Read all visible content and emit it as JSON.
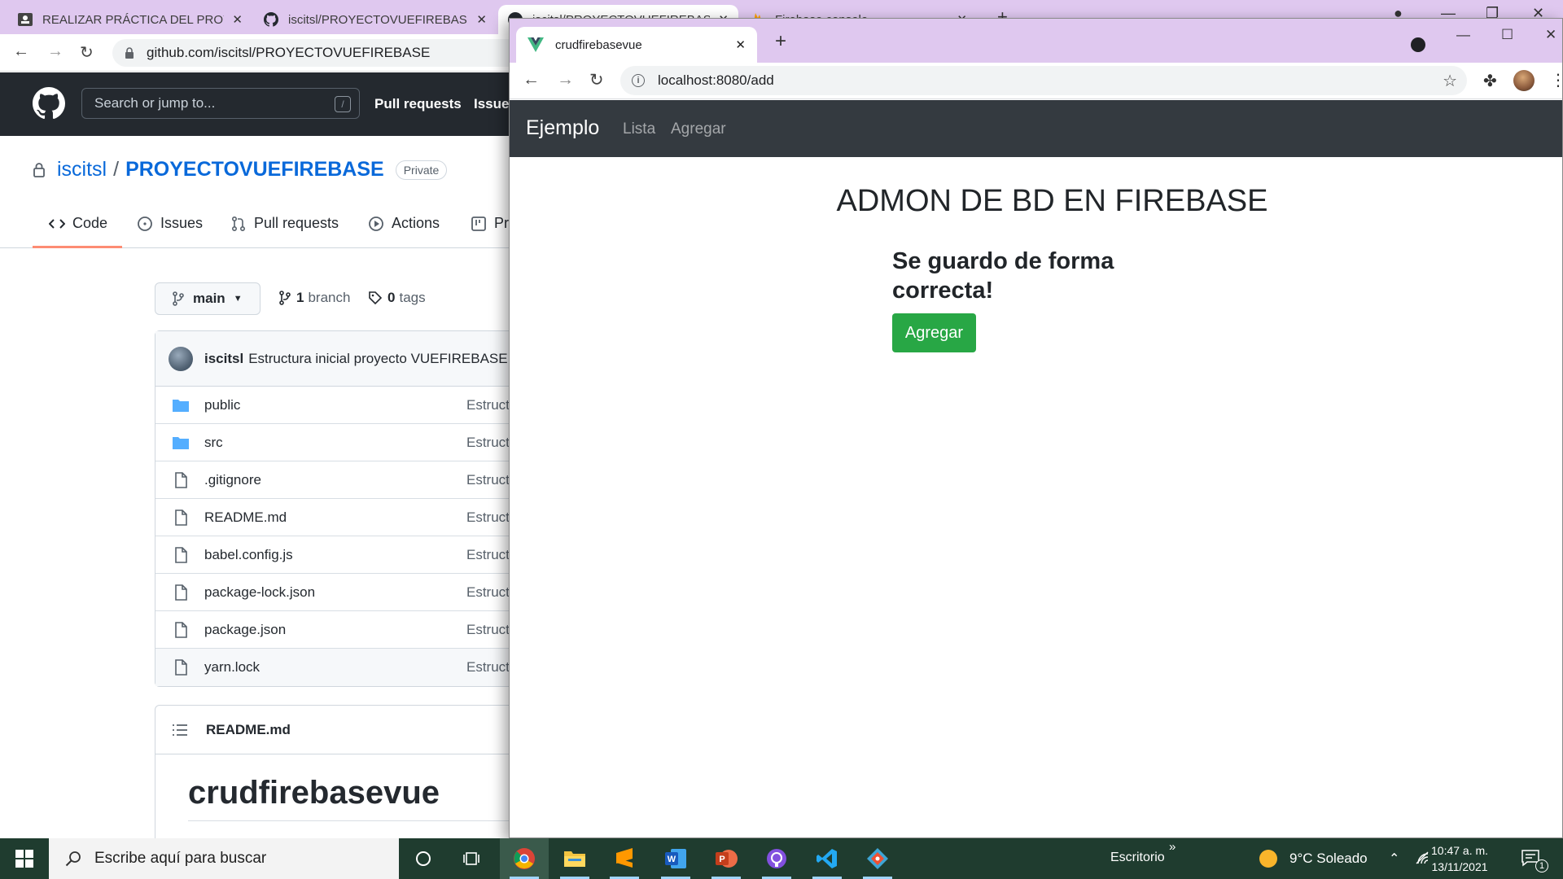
{
  "back_window": {
    "tabs": [
      {
        "title": "REALIZAR PRÁCTICA DEL PROYECTO",
        "close": "✕"
      },
      {
        "title": "iscitsl/PROYECTOVUEFIREBASE: C",
        "close": "✕"
      },
      {
        "title": "iscitsl/PROYECTOVUEFIREBASE: C",
        "close": "✕"
      },
      {
        "title": "Firebase console",
        "close": "✕"
      }
    ],
    "url": "github.com/iscitsl/PROYECTOVUEFIREBASE",
    "github": {
      "search_placeholder": "Search or jump to...",
      "search_shortcut": "/",
      "nav": [
        "Pull requests",
        "Issues"
      ],
      "owner": "iscitsl",
      "separator": "/",
      "repo": "PROYECTOVUEFIREBASE",
      "visibility": "Private",
      "tabs": [
        "Code",
        "Issues",
        "Pull requests",
        "Actions",
        "Pr"
      ],
      "branch": "main",
      "branch_count": "1",
      "branch_label": "branch",
      "tag_count": "0",
      "tag_label": "tags",
      "commit_author": "iscitsl",
      "commit_message": "Estructura inicial proyecto VUEFIREBASE",
      "files": [
        {
          "name": "public",
          "type": "folder",
          "message": "Estruct"
        },
        {
          "name": "src",
          "type": "folder",
          "message": "Estruct"
        },
        {
          "name": ".gitignore",
          "type": "file",
          "message": "Estruct"
        },
        {
          "name": "README.md",
          "type": "file",
          "message": "Estruct"
        },
        {
          "name": "babel.config.js",
          "type": "file",
          "message": "Estruct"
        },
        {
          "name": "package-lock.json",
          "type": "file",
          "message": "Estruct"
        },
        {
          "name": "package.json",
          "type": "file",
          "message": "Estruct"
        },
        {
          "name": "yarn.lock",
          "type": "file",
          "message": "Estruct"
        }
      ],
      "readme_title": "README.md",
      "readme_heading": "crudfirebasevue"
    }
  },
  "front_window": {
    "tab_title": "crudfirebasevue",
    "tab_close": "✕",
    "new_tab": "+",
    "url": "localhost:8080/add",
    "app": {
      "brand": "Ejemplo",
      "links": [
        "Lista",
        "Agregar"
      ],
      "heading": "ADMON DE BD EN FIREBASE",
      "message": "Se guardo de forma correcta!",
      "button_label": "Agregar",
      "button_color": "#28a745",
      "navbar_color": "#343a40"
    }
  },
  "taskbar": {
    "search_placeholder": "Escribe aquí para buscar",
    "desktop_label": "Escritorio",
    "chevron": "»",
    "weather": "9°C  Soleado",
    "time": "10:47 a. m.",
    "date": "13/11/2021",
    "notification_count": "1",
    "pinned": [
      "task-view-icon",
      "chrome-icon",
      "file-explorer-icon",
      "sublime-text-icon",
      "word-icon",
      "powerpoint-icon",
      "github-desktop-icon",
      "vscode-icon",
      "git-icon"
    ]
  }
}
